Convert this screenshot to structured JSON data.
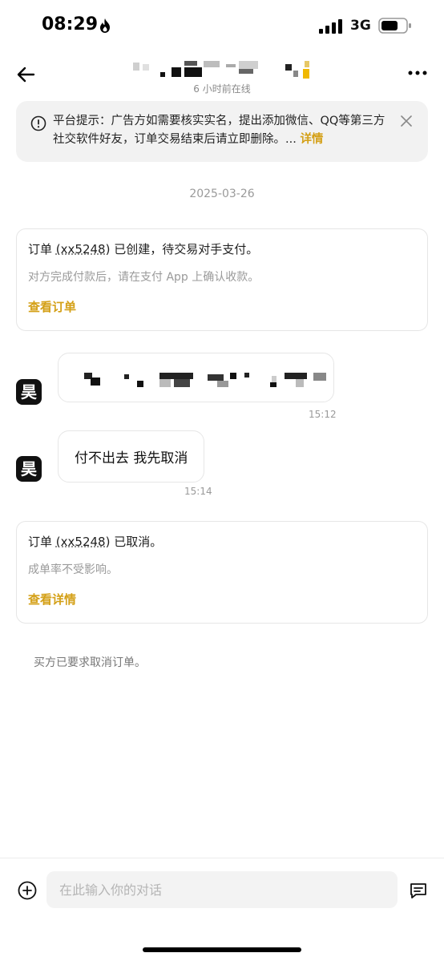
{
  "status_bar": {
    "time": "08:29",
    "network": "3G"
  },
  "header": {
    "subtitle": "6 小时前在线"
  },
  "notice": {
    "text": "平台提示：广告方如需要核实实名，提出添加微信、QQ等第三方社交软件好友，订单交易结束后请立即删除。...",
    "link": "详情"
  },
  "date_separator": "2025-03-26",
  "order_created": {
    "prefix": "订单",
    "order_id": "(xx5248)",
    "suffix": "已创建，待交易对手支付。",
    "sub": "对方完成付款后，请在支付 App 上确认收款。",
    "link": "查看订单"
  },
  "messages": [
    {
      "avatar": "昊",
      "text": "",
      "time": "15:12"
    },
    {
      "avatar": "昊",
      "text": "付不出去  我先取消",
      "time": "15:14"
    }
  ],
  "order_cancelled": {
    "prefix": "订单",
    "order_id": "(xx5248)",
    "suffix": "已取消。",
    "sub": "成单率不受影响。",
    "link": "查看详情"
  },
  "system_message": "买方已要求取消订单。",
  "input": {
    "placeholder": "在此输入你的对话",
    "value": ""
  },
  "colors": {
    "accent": "#d4a017",
    "muted": "#9a9a9a",
    "notice_bg": "#f2f2f2"
  }
}
